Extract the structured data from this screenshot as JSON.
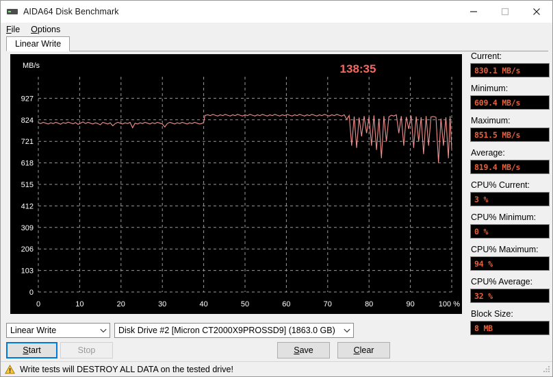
{
  "window": {
    "title": "AIDA64 Disk Benchmark",
    "icon": "disk-drive-icon",
    "minimize_label": "–",
    "maximize_label": "□",
    "close_label": "✕"
  },
  "menu": {
    "items": [
      {
        "label": "File",
        "accel": "F"
      },
      {
        "label": "Options",
        "accel": "O"
      }
    ]
  },
  "tabs": [
    {
      "label": "Linear Write",
      "selected": true
    }
  ],
  "sidebar": {
    "stats": [
      {
        "label": "Current:",
        "value": "830.1 MB/s",
        "name": "current"
      },
      {
        "label": "Minimum:",
        "value": "609.4 MB/s",
        "name": "minimum"
      },
      {
        "label": "Maximum:",
        "value": "851.5 MB/s",
        "name": "maximum"
      },
      {
        "label": "Average:",
        "value": "819.4 MB/s",
        "name": "average"
      },
      {
        "label": "CPU% Current:",
        "value": "3 %",
        "name": "cpu-current"
      },
      {
        "label": "CPU% Minimum:",
        "value": "0 %",
        "name": "cpu-minimum"
      },
      {
        "label": "CPU% Maximum:",
        "value": "94 %",
        "name": "cpu-maximum"
      },
      {
        "label": "CPU% Average:",
        "value": "32 %",
        "name": "cpu-average"
      },
      {
        "label": "Block Size:",
        "value": "8 MB",
        "name": "block-size"
      }
    ]
  },
  "controls": {
    "test_select": {
      "value": "Linear Write"
    },
    "drive_select": {
      "value": "Disk Drive #2  [Micron  CT2000X9PROSSD9]  (1863.0 GB)"
    },
    "start_label": "Start",
    "start_accel": "S",
    "stop_label": "Stop",
    "stop_accel": "S",
    "save_label": "Save",
    "save_accel": "S",
    "clear_label": "Clear",
    "clear_accel": "C"
  },
  "statusbar": {
    "warning_icon": "warning-triangle-icon",
    "text": "Write tests will DESTROY ALL DATA on the tested drive!"
  },
  "colors": {
    "trace": "#f0918e",
    "timer": "#f46a62",
    "field_text": "#e8603c",
    "chart_bg": "#000000",
    "grid": "#9a9a9a",
    "focus": "#0078d7"
  },
  "chart_data": {
    "type": "line",
    "title": "",
    "timer_label": "138:35",
    "xlabel": "100 %",
    "ylabel": "MB/s",
    "xlim": [
      0,
      100
    ],
    "ylim": [
      0,
      1030
    ],
    "grid": true,
    "legend": "none",
    "xticks": [
      0,
      10,
      20,
      30,
      40,
      50,
      60,
      70,
      80,
      90,
      100
    ],
    "xticklabels": [
      "0",
      "10",
      "20",
      "30",
      "40",
      "50",
      "60",
      "70",
      "80",
      "90",
      "100 %"
    ],
    "yticks": [
      0,
      103,
      206,
      309,
      412,
      515,
      618,
      721,
      824,
      927
    ],
    "yticklabels": [
      "0",
      "103",
      "206",
      "309",
      "412",
      "515",
      "618",
      "721",
      "824",
      "927"
    ],
    "series": [
      {
        "name": "Linear Write",
        "color": "#f0918e",
        "x": [
          0,
          0.6,
          1.2,
          1.8,
          2.4,
          3,
          3.6,
          4.2,
          4.8,
          5.4,
          6,
          6.6,
          7.2,
          7.8,
          8.4,
          9,
          9.6,
          10.2,
          10.8,
          11.4,
          12,
          12.6,
          13.2,
          13.8,
          14.4,
          15,
          15.6,
          16.2,
          16.8,
          17.4,
          18,
          18.6,
          19.2,
          19.8,
          20.4,
          21,
          21.6,
          22.2,
          22.8,
          23.4,
          24,
          24.6,
          25.2,
          25.8,
          26.4,
          27,
          27.6,
          28.2,
          28.8,
          29.4,
          30,
          30.6,
          31.2,
          31.8,
          32.4,
          33,
          33.6,
          34.2,
          34.8,
          35.4,
          36,
          36.6,
          37.2,
          37.8,
          38.4,
          39,
          39.4,
          39.7,
          40,
          40.3,
          41,
          41.6,
          42.2,
          42.8,
          43.4,
          44,
          44.6,
          45.2,
          45.8,
          46.4,
          47,
          47.6,
          48.2,
          48.8,
          49.4,
          50,
          50.6,
          51.2,
          51.8,
          52.4,
          53,
          53.6,
          54.2,
          54.8,
          55.4,
          56,
          56.6,
          57.2,
          57.8,
          58.4,
          59,
          59.6,
          60.2,
          60.8,
          61.4,
          62,
          62.6,
          63.2,
          63.8,
          64.4,
          65,
          65.6,
          66.2,
          66.8,
          67.4,
          68,
          68.6,
          69.2,
          69.8,
          70.4,
          71,
          71.6,
          72.2,
          72.8,
          73.4,
          74,
          74.6,
          75.2,
          75.8,
          76.4,
          77,
          77.6,
          78.2,
          78.8,
          79.4,
          80,
          80.6,
          81.2,
          81.8,
          82.4,
          83,
          83.6,
          84.2,
          84.8,
          85.4,
          86,
          86.6,
          87.2,
          87.8,
          88.4,
          89,
          89.6,
          90.2,
          90.8,
          91.4,
          92,
          92.6,
          93.2,
          93.8,
          94.4,
          95,
          95.6,
          96.2,
          96.8,
          97.4,
          98,
          98.6,
          99.2,
          99.6,
          100
        ],
        "y": [
          810,
          806,
          812,
          808,
          804,
          810,
          806,
          812,
          808,
          803,
          811,
          807,
          813,
          809,
          805,
          811,
          802,
          808,
          814,
          806,
          812,
          808,
          804,
          810,
          806,
          800,
          812,
          808,
          804,
          810,
          795,
          806,
          812,
          808,
          804,
          810,
          806,
          812,
          786,
          808,
          804,
          810,
          806,
          812,
          808,
          804,
          810,
          806,
          812,
          808,
          804,
          790,
          806,
          812,
          808,
          804,
          810,
          806,
          812,
          808,
          804,
          810,
          806,
          812,
          808,
          804,
          806,
          808,
          812,
          845,
          848,
          844,
          850,
          846,
          842,
          848,
          844,
          850,
          846,
          842,
          848,
          844,
          850,
          846,
          842,
          848,
          844,
          850,
          846,
          842,
          848,
          844,
          850,
          846,
          842,
          848,
          844,
          850,
          846,
          842,
          848,
          844,
          850,
          846,
          842,
          848,
          844,
          850,
          846,
          842,
          848,
          844,
          850,
          846,
          842,
          848,
          844,
          850,
          846,
          842,
          848,
          844,
          850,
          846,
          842,
          848,
          826,
          845,
          700,
          840,
          690,
          835,
          745,
          842,
          760,
          838,
          700,
          845,
          680,
          830,
          640,
          842,
          720,
          838,
          846,
          842,
          848,
          760,
          842,
          700,
          838,
          780,
          844,
          690,
          840,
          720,
          836,
          660,
          842,
          700,
          838,
          840,
          836,
          620,
          830,
          700,
          836,
          640,
          842,
          680,
          838,
          720,
          834,
          700,
          840,
          660,
          836,
          700,
          842,
          690,
          838,
          730,
          836,
          700,
          840,
          690,
          836,
          650,
          842,
          700,
          838,
          680,
          834,
          700,
          840,
          690,
          836,
          660,
          842,
          700,
          838,
          720,
          834,
          700,
          840,
          609,
          836,
          700,
          842,
          680,
          838,
          700,
          836,
          690,
          840,
          700,
          836,
          680,
          842,
          700,
          838,
          660,
          834,
          700,
          840,
          690,
          836,
          700,
          842,
          680,
          838,
          830
        ]
      }
    ]
  }
}
